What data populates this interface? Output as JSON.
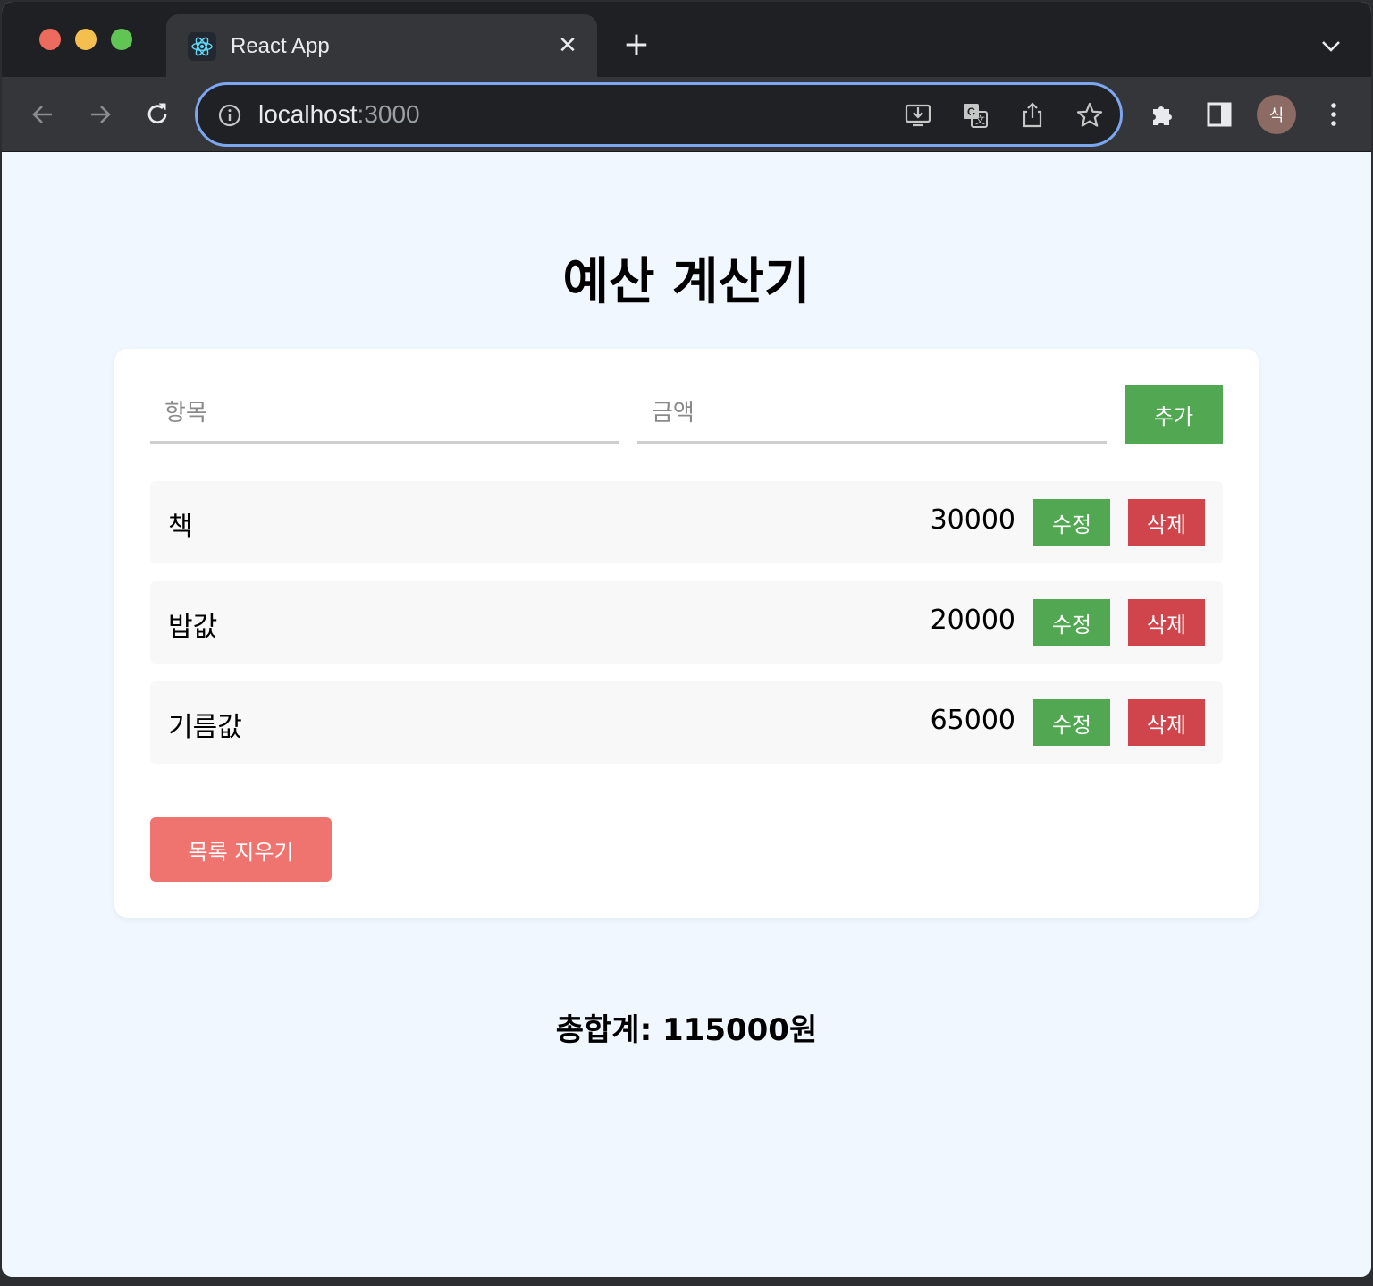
{
  "browser": {
    "tab_title": "React App",
    "tab_close": "✕",
    "new_tab": "+",
    "url_host": "localhost",
    "url_port": ":3000",
    "avatar_initial": "식"
  },
  "app": {
    "title": "예산 계산기",
    "item_placeholder": "항목",
    "amount_placeholder": "금액",
    "add_label": "추가",
    "edit_label": "수정",
    "delete_label": "삭제",
    "clear_label": "목록 지우기",
    "items": [
      {
        "name": "책",
        "amount": "30000"
      },
      {
        "name": "밥값",
        "amount": "20000"
      },
      {
        "name": "기름값",
        "amount": "65000"
      }
    ],
    "total_text": "총합계: 115000원"
  },
  "colors": {
    "accent_green": "#52a852",
    "danger_red": "#d0454c",
    "clear_red": "#ef7470",
    "page_bg": "#f0f7ff"
  }
}
